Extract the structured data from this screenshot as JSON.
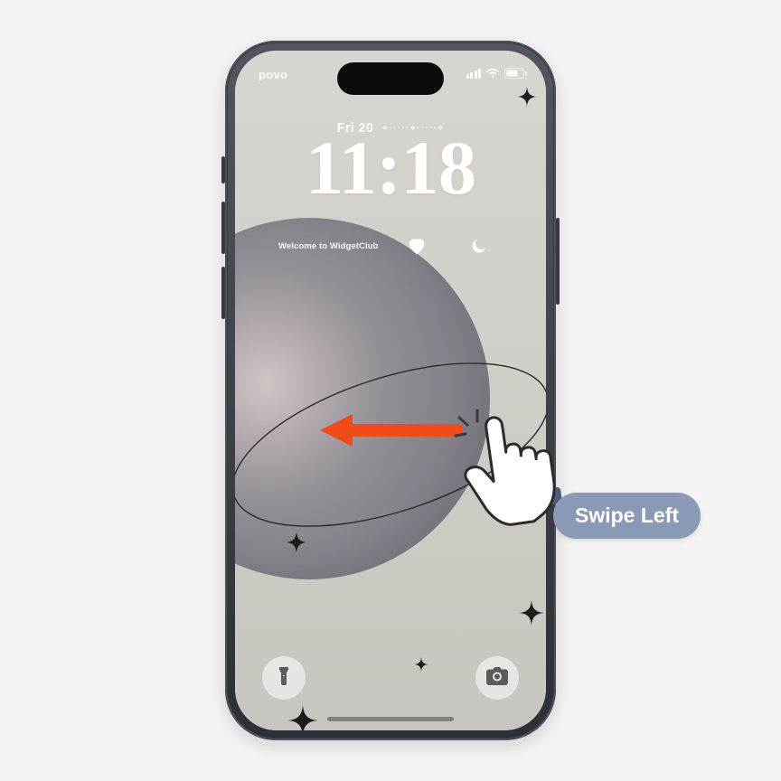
{
  "status": {
    "carrier": "povo"
  },
  "lockscreen": {
    "date": "Fri 20",
    "time": "11:18",
    "widget_text": "Welcome to WidgetClub"
  },
  "overlay": {
    "swipe_label": "Swipe Left"
  },
  "icons": {
    "heart": "heart-icon",
    "moon": "moon-icon",
    "flashlight": "flashlight-icon",
    "camera": "camera-icon",
    "signal": "signal-icon",
    "wifi": "wifi-icon",
    "battery": "battery-icon",
    "sparkle": "sparkle-icon",
    "swipe_arrow": "arrow-left-icon",
    "swipe_hand": "pointer-hand-icon"
  },
  "colors": {
    "accent_arrow": "#f04b1a",
    "label_bubble": "#8a9ab5"
  }
}
